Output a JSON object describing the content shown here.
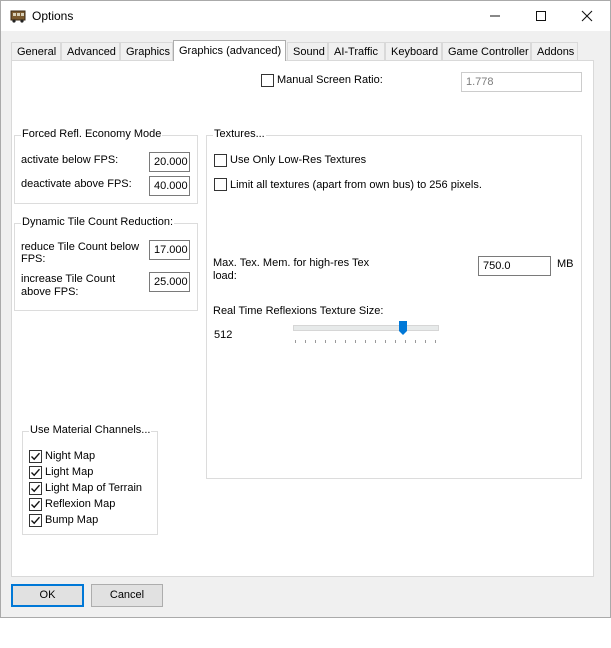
{
  "window": {
    "title": "Options",
    "controls": [
      "minimize-icon",
      "maximize-icon",
      "close-icon"
    ]
  },
  "tabs": [
    {
      "label": "General",
      "active": false
    },
    {
      "label": "Advanced",
      "active": false
    },
    {
      "label": "Graphics",
      "active": false
    },
    {
      "label": "Graphics (advanced)",
      "active": true
    },
    {
      "label": "Sound",
      "active": false
    },
    {
      "label": "AI-Traffic",
      "active": false
    },
    {
      "label": "Keyboard",
      "active": false
    },
    {
      "label": "Game Controller",
      "active": false
    },
    {
      "label": "Addons",
      "active": false
    }
  ],
  "screen_ratio": {
    "label": "Manual Screen Ratio:",
    "checked": false,
    "value": "1.778",
    "enabled": false
  },
  "economy_mode": {
    "title": "Forced Refl. Economy Mode",
    "activate_label": "activate below FPS:",
    "activate_value": "20.000",
    "deactivate_label": "deactivate above FPS:",
    "deactivate_value": "40.000"
  },
  "tile_reduction": {
    "title": "Dynamic Tile Count Reduction:",
    "reduce_label_1": "reduce Tile Count below",
    "reduce_label_2": "FPS:",
    "reduce_value": "17.000",
    "increase_label_1": "increase Tile Count",
    "increase_label_2": "above FPS:",
    "increase_value": "25.000"
  },
  "textures": {
    "title": "Textures...",
    "low_res_label": "Use Only Low-Res Textures",
    "low_res_checked": false,
    "limit_label": "Limit all textures (apart from own bus) to 256 pixels.",
    "limit_checked": false,
    "max_mem_label_1": "Max. Tex. Mem. for high-res Tex",
    "max_mem_label_2": "load:",
    "max_mem_value": "750.0",
    "max_mem_unit": "MB",
    "reflexion_label": "Real Time Reflexions Texture Size:",
    "reflexion_value": "512",
    "reflexion_slider_fraction": 0.75
  },
  "material_channels": {
    "title": "Use Material Channels...",
    "items": [
      {
        "label": "Night Map",
        "checked": true
      },
      {
        "label": "Light Map",
        "checked": true
      },
      {
        "label": "Light Map of Terrain",
        "checked": true
      },
      {
        "label": "Reflexion Map",
        "checked": true
      },
      {
        "label": "Bump Map",
        "checked": true
      }
    ]
  },
  "footer": {
    "ok_label": "OK",
    "cancel_label": "Cancel"
  },
  "colors": {
    "accent": "#0078d7",
    "panel": "#ffffff",
    "window_bg": "#f0f0f0"
  }
}
